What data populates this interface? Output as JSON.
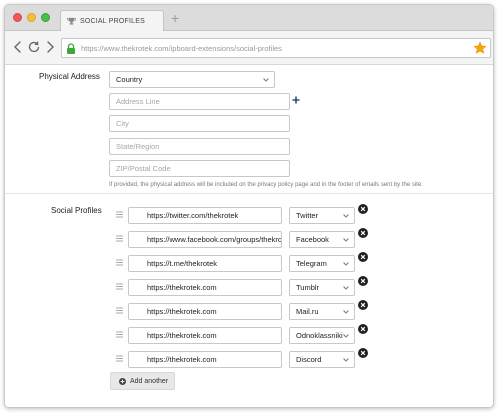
{
  "browser": {
    "tab_title": "SOCIAL PROFILES",
    "url": "https://www.thekrotek.com/ipboard-extensions/social-profiles"
  },
  "address": {
    "label": "Physical Address",
    "country": "Country",
    "address_line_placeholder": "Address Line",
    "city_placeholder": "City",
    "state_placeholder": "State/Region",
    "zip_placeholder": "ZIP/Postal Code",
    "help": "If provided, the physical address will be included on the privacy policy page and in the footer of emails sent by the site."
  },
  "social": {
    "label": "Social Profiles",
    "rows": [
      {
        "url": "https://twitter.com/thekrotek",
        "service": "Twitter"
      },
      {
        "url": "https://www.facebook.com/groups/thekrotek",
        "service": "Facebook"
      },
      {
        "url": "https://t.me/thekrotek",
        "service": "Telegram"
      },
      {
        "url": "https://thekrotek.com",
        "service": "Tumblr"
      },
      {
        "url": "https://thekrotek.com",
        "service": "Mail.ru"
      },
      {
        "url": "https://thekrotek.com",
        "service": "Odnoklassniki"
      },
      {
        "url": "https://thekrotek.com",
        "service": "Discord"
      }
    ],
    "add_label": "Add another"
  }
}
